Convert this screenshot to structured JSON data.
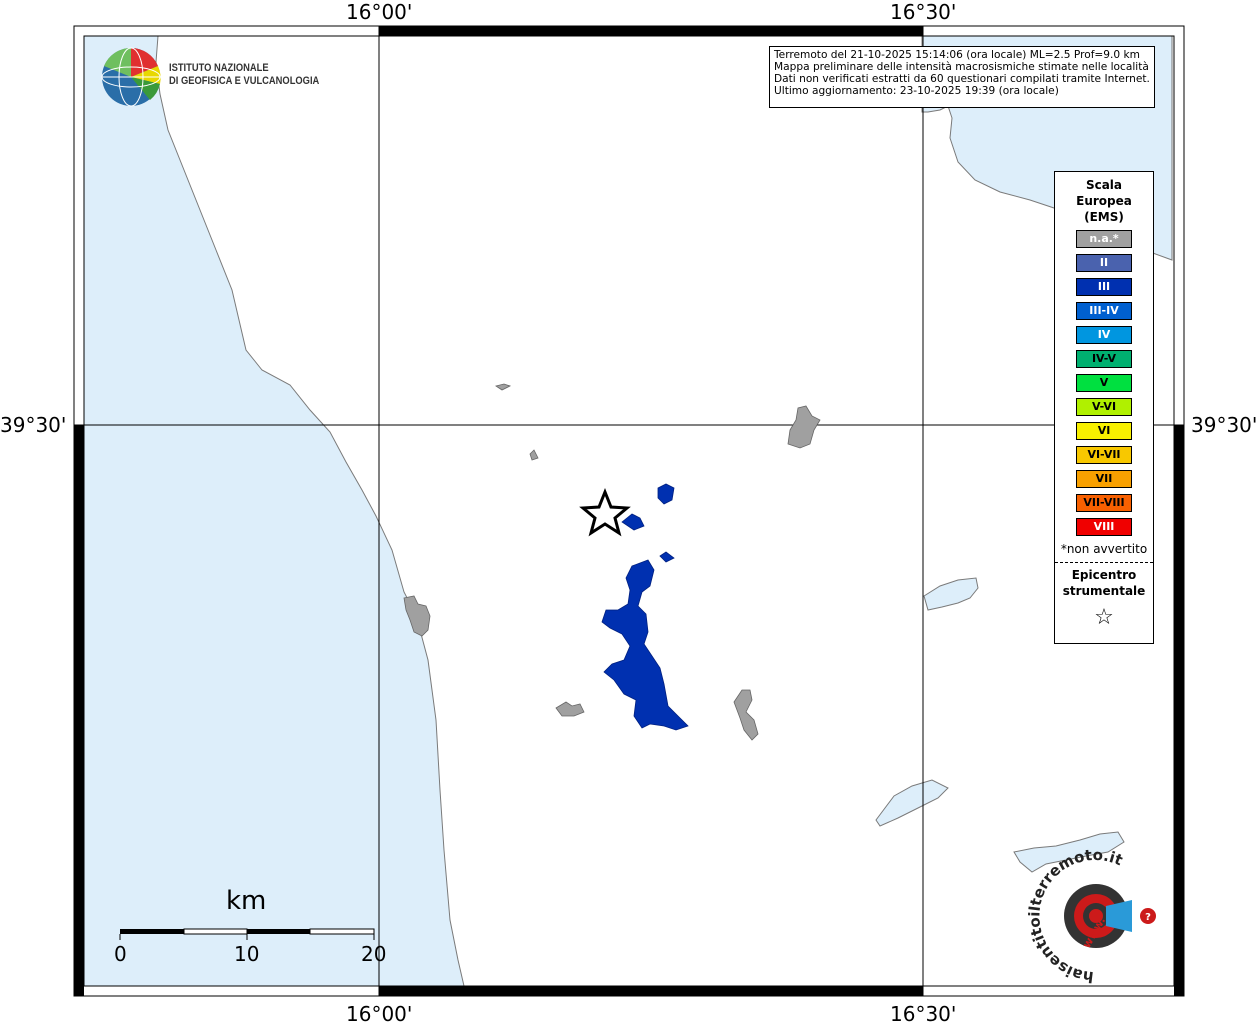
{
  "map": {
    "graticule": {
      "top_left": "16°00'",
      "top_right": "16°30'",
      "bottom_left": "16°00'",
      "bottom_right": "16°30'",
      "left_lat": "39°30'",
      "right_lat": "39°30'"
    },
    "colors": {
      "sea": "#ddeefa",
      "land": "#ffffff",
      "coast": "#7a7a7a",
      "not_felt": "#a0a0a0",
      "intensity_III": "#0030b0"
    }
  },
  "logo": {
    "line1": "ISTITUTO NAZIONALE",
    "line2": "DI GEOFISICA E VULCANOLOGIA"
  },
  "info": {
    "line1": "Terremoto del 21-10-2025 15:14:06 (ora locale) ML=2.5 Prof=9.0 km",
    "line2": "Mappa preliminare delle intensità macrosismiche stimate nelle località",
    "line3": "Dati non verificati estratti da 60 questionari compilati tramite Internet.",
    "line4": "Ultimo aggiornamento: 23-10-2025 19:39 (ora locale)"
  },
  "legend": {
    "title1": "Scala",
    "title2": "Europea",
    "title3": "(EMS)",
    "items": [
      {
        "label": "n.a.*",
        "color": "#a0a0a0",
        "text_color": "#ffffff"
      },
      {
        "label": "II",
        "color": "#4a62ae",
        "text_color": "#ffffff"
      },
      {
        "label": "III",
        "color": "#0030b0",
        "text_color": "#ffffff"
      },
      {
        "label": "III-IV",
        "color": "#0060d0",
        "text_color": "#ffffff"
      },
      {
        "label": "IV",
        "color": "#0096e0",
        "text_color": "#ffffff"
      },
      {
        "label": "IV-V",
        "color": "#00b070",
        "text_color": "#000000"
      },
      {
        "label": "V",
        "color": "#00e040",
        "text_color": "#000000"
      },
      {
        "label": "V-VI",
        "color": "#b0f000",
        "text_color": "#000000"
      },
      {
        "label": "VI",
        "color": "#f8f000",
        "text_color": "#000000"
      },
      {
        "label": "VI-VII",
        "color": "#f8c800",
        "text_color": "#000000"
      },
      {
        "label": "VII",
        "color": "#f8a000",
        "text_color": "#000000"
      },
      {
        "label": "VII-VIII",
        "color": "#f86000",
        "text_color": "#000000"
      },
      {
        "label": "VIII",
        "color": "#f00000",
        "text_color": "#ffffff"
      }
    ],
    "note": "*non avvertito",
    "epicentro1": "Epicentro",
    "epicentro2": "strumentale",
    "star": "☆"
  },
  "scale_bar": {
    "unit": "km",
    "ticks": [
      "0",
      "10",
      "20"
    ]
  },
  "haisentito": {
    "text": "haisentitoilterremoto.it",
    "url": "www."
  }
}
